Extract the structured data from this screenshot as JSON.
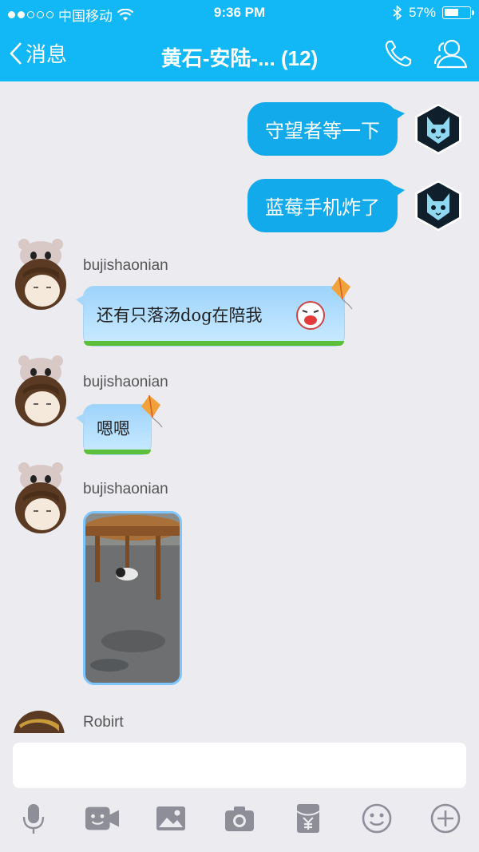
{
  "status_bar": {
    "carrier": "中国移动",
    "time": "9:36 PM",
    "battery": "57%",
    "battery_level": 0.57
  },
  "nav": {
    "back_label": "消息",
    "title": "黄石-安陆-... (12)"
  },
  "messages": [
    {
      "type": "out",
      "text": "守望者等一下"
    },
    {
      "type": "out",
      "text": "蓝莓手机炸了"
    },
    {
      "type": "in",
      "sender": "bujishaonian",
      "text": "还有只落汤dog在陪我"
    },
    {
      "type": "in",
      "sender": "bujishaonian",
      "text": "嗯嗯"
    },
    {
      "type": "in",
      "sender": "bujishaonian",
      "image": "photo"
    },
    {
      "type": "in",
      "sender": "Robirt"
    }
  ],
  "input": {
    "placeholder": ""
  },
  "toolbar": [
    "microphone-icon",
    "video-icon",
    "image-icon",
    "camera-icon",
    "red-packet-icon",
    "emoji-icon",
    "plus-icon"
  ],
  "colors": {
    "accent": "#12b7f5",
    "out_bubble": "#12aaeb",
    "background": "#ebebf0"
  }
}
